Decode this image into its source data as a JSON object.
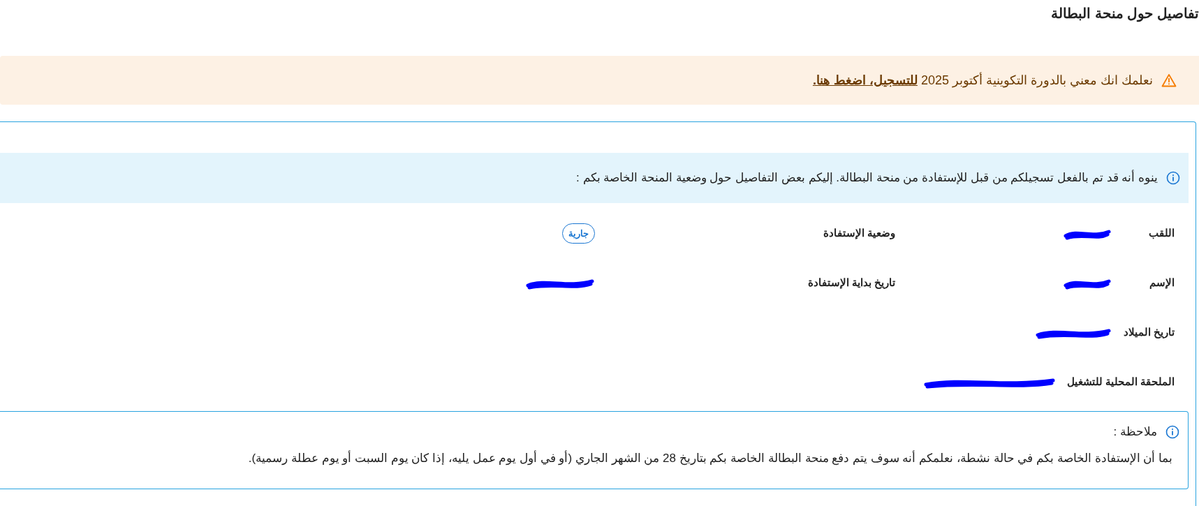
{
  "title": "تفاصيل حول منحة البطالة",
  "alert": {
    "text": "نعلمك انك معني بالدورة التكوينية أكتوبر 2025",
    "link": "للتسجيل، اضغط هنا."
  },
  "info": {
    "text": "ينوه أنه قد تم بالفعل تسجيلكم من قبل للإستفادة من منحة البطالة. إليكم بعض التفاصيل حول وضعية المنحة الخاصة بكم :"
  },
  "fields": [
    {
      "label": "اللقب",
      "redacted": true
    },
    {
      "label": "وضعية الإستفادة",
      "badge": "جارية"
    },
    {
      "label": "الإسم",
      "redacted": true
    },
    {
      "label": "تاريخ بداية الإستفادة",
      "redacted": true
    },
    {
      "label": "تاريخ الميلاد",
      "redacted": true
    },
    {
      "label": "الملحقة المحلية للتشغيل",
      "redacted": true
    }
  ],
  "note": {
    "title": "ملاحظة :",
    "text": "بما أن الإستفادة الخاصة بكم في حالة نشطة، نعلمكم أنه سوف يتم دفع منحة البطالة الخاصة بكم بتاريخ 28 من الشهر الجاري (أو في أول يوم عمل يليه، إذا كان يوم السبت أو يوم عطلة رسمية)."
  }
}
